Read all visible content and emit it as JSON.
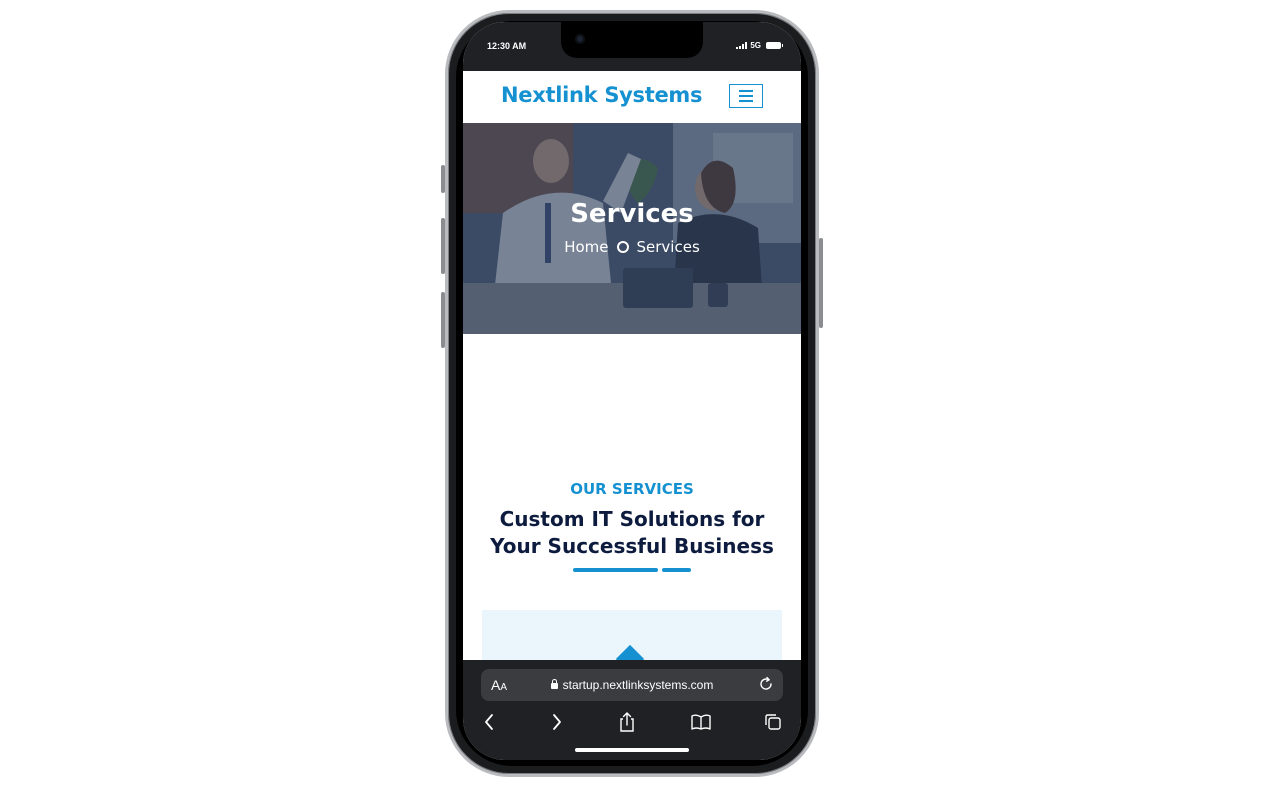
{
  "status_bar": {
    "time": "12:30 AM",
    "network": "5G"
  },
  "header": {
    "logo": "Nextlink Systems"
  },
  "hero": {
    "title": "Services",
    "breadcrumb": {
      "home": "Home",
      "current": "Services"
    }
  },
  "services_section": {
    "subtitle": "OUR SERVICES",
    "title_line1": "Custom IT Solutions for",
    "title_line2": "Your Successful Business"
  },
  "browser": {
    "text_size_label": "A",
    "text_size_label_small": "A",
    "url": "startup.nextlinksystems.com"
  },
  "icons": {
    "menu": "hamburger-icon",
    "breadcrumb_separator": "circle-icon",
    "reload": "reload-icon",
    "back": "chevron-left-icon",
    "forward": "chevron-right-icon",
    "share": "share-icon",
    "bookmarks": "book-icon",
    "tabs": "tabs-icon"
  },
  "colors": {
    "brand": "#1591d1",
    "heading": "#0d1b3e",
    "card_bg": "#eaf5fc",
    "browser_chrome": "#202124"
  }
}
